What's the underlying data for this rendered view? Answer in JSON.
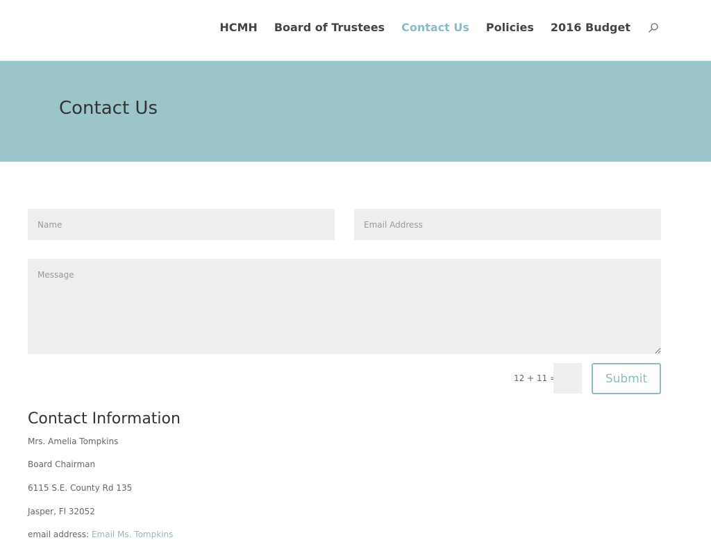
{
  "nav": {
    "items": [
      {
        "label": "HCMH",
        "active": false
      },
      {
        "label": "Board of Trustees",
        "active": false
      },
      {
        "label": "Contact Us",
        "active": true
      },
      {
        "label": "Policies",
        "active": false
      },
      {
        "label": "2016 Budget",
        "active": false
      }
    ],
    "search_icon": "search-icon"
  },
  "hero": {
    "title": "Contact Us"
  },
  "form": {
    "name_placeholder": "Name",
    "email_placeholder": "Email Address",
    "message_placeholder": "Message",
    "captcha_question": "12 + 11 =",
    "captcha_value": "",
    "submit_label": "Submit"
  },
  "contact": {
    "heading": "Contact Information",
    "name": "Mrs. Amelia Tompkins",
    "role": "Board Chairman",
    "street": "6115 S.E. County Rd 135",
    "city": "Jasper, Fl  32052",
    "email_label": "email address:",
    "email_link": "Email Ms. Tompkins"
  },
  "colors": {
    "accent": "#8dbbc2",
    "hero_bg": "#9cc5ca",
    "field_bg": "#eeeeee"
  }
}
